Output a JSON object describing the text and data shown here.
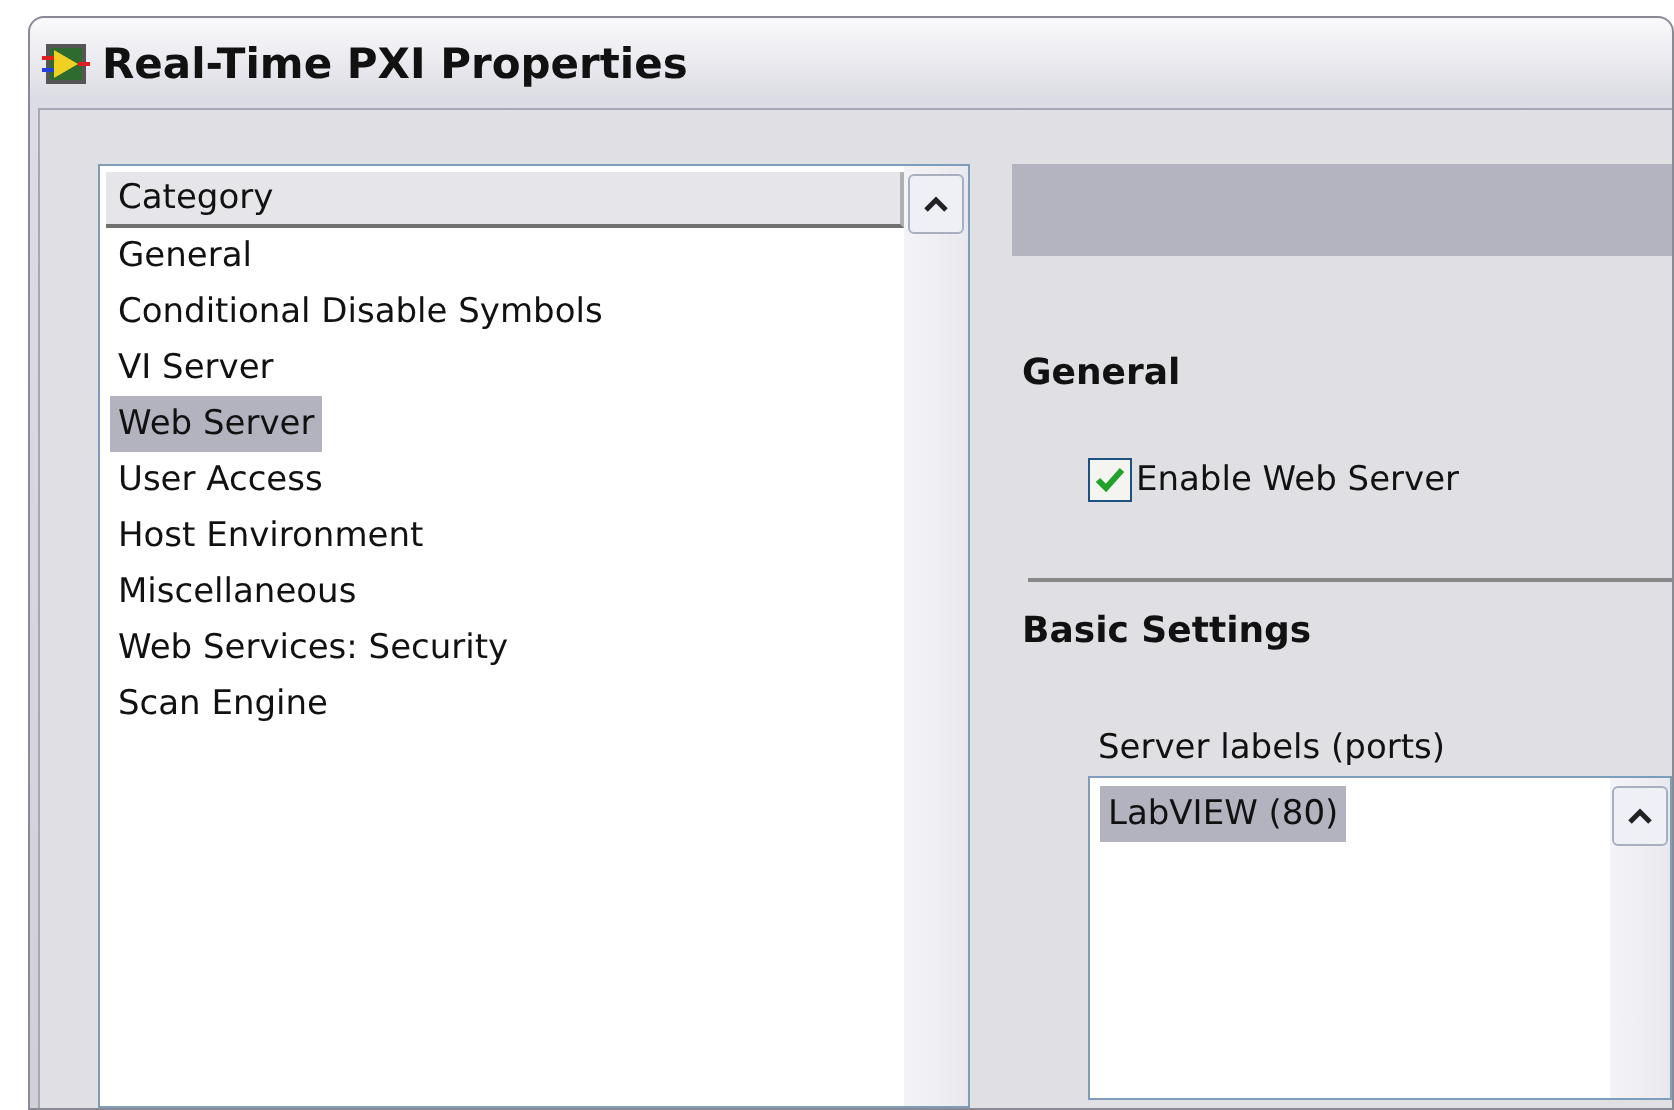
{
  "window": {
    "title": "Real-Time PXI Properties"
  },
  "category_list": {
    "header": "Category",
    "items": [
      {
        "label": "General",
        "selected": false
      },
      {
        "label": "Conditional Disable Symbols",
        "selected": false
      },
      {
        "label": "VI Server",
        "selected": false
      },
      {
        "label": "Web Server",
        "selected": true
      },
      {
        "label": "User Access",
        "selected": false
      },
      {
        "label": "Host Environment",
        "selected": false
      },
      {
        "label": "Miscellaneous",
        "selected": false
      },
      {
        "label": "Web Services: Security",
        "selected": false
      },
      {
        "label": "Scan Engine",
        "selected": false
      }
    ]
  },
  "panel": {
    "section_general": "General",
    "enable_web_server": {
      "label": "Enable Web Server",
      "checked": true
    },
    "section_basic": "Basic Settings",
    "server_labels": {
      "label": "Server labels (ports)",
      "items": [
        {
          "label": "LabVIEW (80)",
          "selected": true
        }
      ]
    }
  }
}
